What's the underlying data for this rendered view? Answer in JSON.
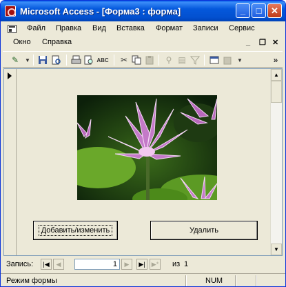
{
  "window": {
    "title": "Microsoft Access - [Форма3 : форма]",
    "minimize_label": "_",
    "maximize_label": "□",
    "close_label": "✕"
  },
  "menu": {
    "row1": [
      "Файл",
      "Правка",
      "Вид",
      "Вставка",
      "Формат",
      "Записи",
      "Сервис"
    ],
    "row2": [
      "Окно",
      "Справка"
    ]
  },
  "toolbar": {
    "icons": [
      "design-view-icon",
      "save-icon",
      "print-preview-icon",
      "print-icon",
      "preview-icon",
      "spelling-icon",
      "cut-icon",
      "copy-icon",
      "paste-icon",
      "filter-by-selection-icon",
      "filter-by-form-icon",
      "apply-filter-icon",
      "database-window-icon",
      "new-object-icon"
    ],
    "overflow": "»"
  },
  "form": {
    "add_edit_button": "Добавить/изменить",
    "delete_button": "Удалить",
    "picture": "water-lily-photo"
  },
  "navigation": {
    "label": "Запись:",
    "current_record": "1",
    "of_label": "из",
    "total_records": "1"
  },
  "status": {
    "mode": "Режим формы",
    "num": "NUM"
  }
}
